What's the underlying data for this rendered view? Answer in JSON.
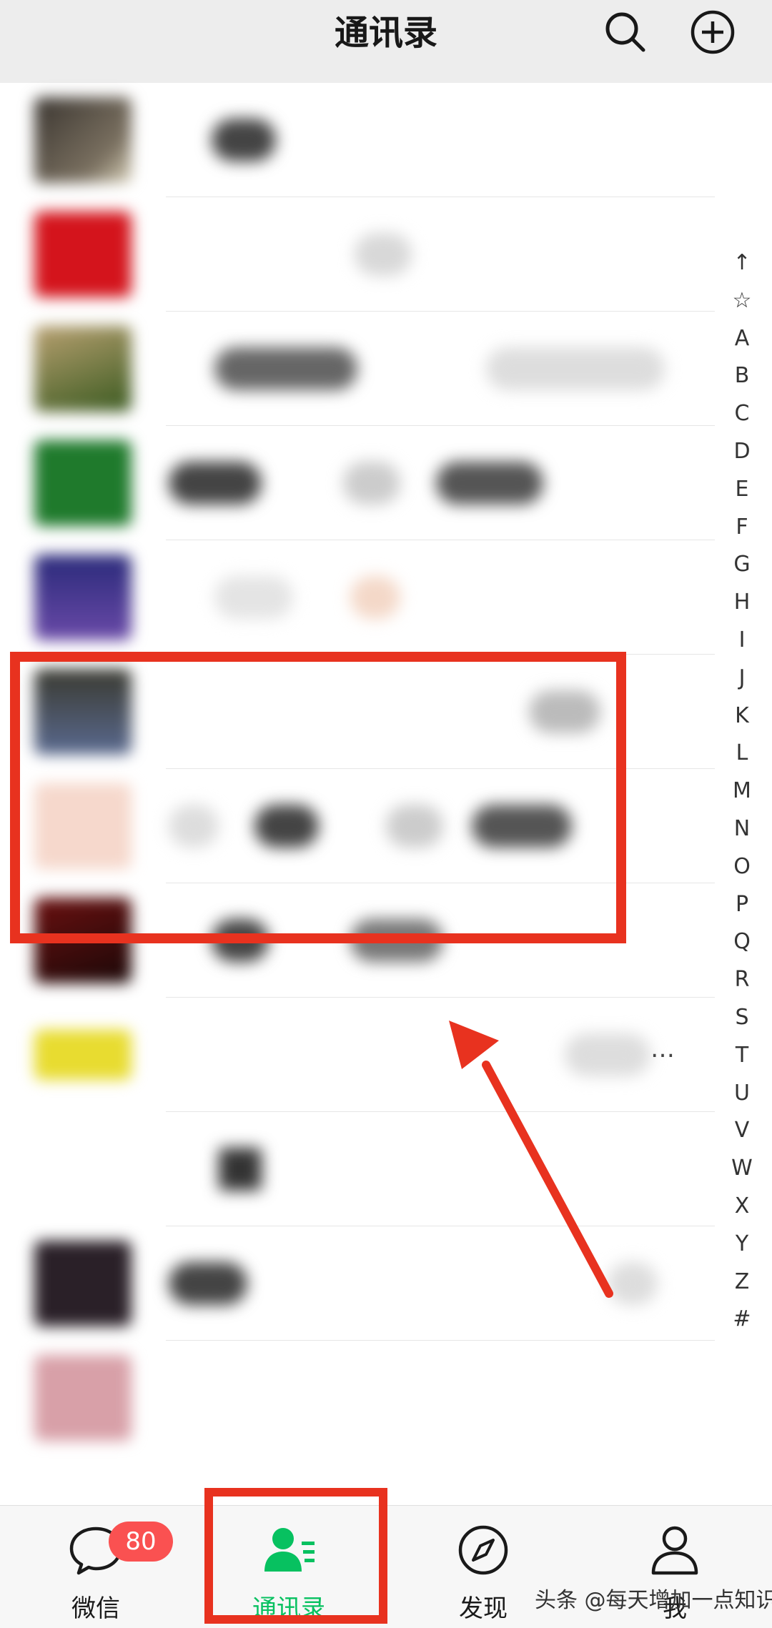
{
  "header": {
    "title": "通讯录",
    "search_icon": "search-icon",
    "add_icon": "plus-circle-icon"
  },
  "contacts": {
    "count_visible": 12,
    "names_blurred": true,
    "partial_text": [
      "…"
    ]
  },
  "index": [
    "↑",
    "☆",
    "A",
    "B",
    "C",
    "D",
    "E",
    "F",
    "G",
    "H",
    "I",
    "J",
    "K",
    "L",
    "M",
    "N",
    "O",
    "P",
    "Q",
    "R",
    "S",
    "T",
    "U",
    "V",
    "W",
    "X",
    "Y",
    "Z",
    "#"
  ],
  "tabbar": {
    "chats": {
      "label": "微信",
      "badge": "80",
      "icon": "chat-bubble-icon"
    },
    "contacts": {
      "label": "通讯录",
      "icon": "contacts-icon",
      "active": true
    },
    "discover": {
      "label": "发现",
      "icon": "compass-icon"
    },
    "me": {
      "label": "我",
      "icon": "person-icon"
    }
  },
  "watermark": "头条 @每天增加一点知识",
  "colors": {
    "accent": "#07c160",
    "badge": "#fa5151",
    "annotation": "#e8321f",
    "header_bg": "#ededed"
  }
}
